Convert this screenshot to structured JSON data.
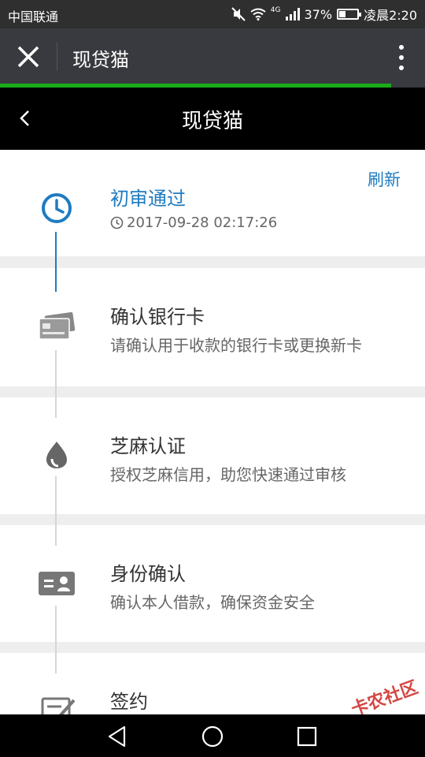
{
  "statusbar": {
    "carrier": "中国联通",
    "network": "4G",
    "battery_percent": "37%",
    "battery_level": 0.37,
    "time": "凌晨2:20"
  },
  "wxheader": {
    "title": "现贷猫",
    "close_icon": "close-icon",
    "more_icon": "more-vertical-icon"
  },
  "load_progress": 0.92,
  "pageheader": {
    "title": "现贷猫",
    "back_icon": "back-chevron-icon"
  },
  "refresh_label": "刷新",
  "steps": [
    {
      "title": "初审通过",
      "time": "2017-09-28 02:17:26",
      "icon": "clock-icon",
      "status": "done"
    },
    {
      "title": "确认银行卡",
      "desc": "请确认用于收款的银行卡或更换新卡",
      "icon": "bank-card-icon",
      "status": "pending"
    },
    {
      "title": "芝麻认证",
      "desc": "授权芝麻信用，助您快速通过审核",
      "icon": "sesame-icon",
      "status": "pending"
    },
    {
      "title": "身份确认",
      "desc": "确认本人借款，确保资金安全",
      "icon": "id-card-icon",
      "status": "pending"
    },
    {
      "title": "签约",
      "icon": "sign-icon",
      "status": "pending"
    }
  ],
  "navbar": {
    "back": "nav-back-icon",
    "home": "nav-home-icon",
    "recent": "nav-recent-icon"
  },
  "watermark": "卡农社区",
  "colors": {
    "accent": "#1e7bc1",
    "progress": "#1aad19",
    "header": "#393a3f"
  }
}
